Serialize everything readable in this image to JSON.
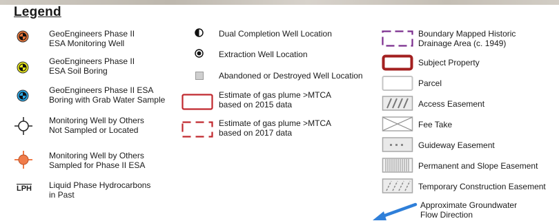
{
  "legend": {
    "title": "Legend",
    "col1": [
      {
        "line1": "GeoEngineers Phase II",
        "line2": "ESA Monitoring Well",
        "color": "#e8763a"
      },
      {
        "line1": "GeoEngineers Phase II",
        "line2": "ESA Soil Boring",
        "color": "#e6e61a"
      },
      {
        "line1": "GeoEngineers Phase II ESA",
        "line2": "Boring with Grab Water Sample",
        "color": "#2aa7e6"
      },
      {
        "line1": "Monitoring Well by Others",
        "line2": "Not Sampled or Located"
      },
      {
        "line1": "Monitoring Well by Others",
        "line2": "Sampled for Phase II ESA",
        "color": "#f07c4a"
      },
      {
        "line1": "Liquid Phase Hydrocarbons",
        "line2": "in Past",
        "symbol_text": "LPH"
      }
    ],
    "col2": [
      {
        "line1": "Dual Completion Well Location"
      },
      {
        "line1": "Extraction Well Location"
      },
      {
        "line1": "Abandoned or Destroyed Well Location"
      },
      {
        "line1": "Estimate of gas plume >MTCA",
        "line2": "based on 2015 data",
        "color": "#c0272d"
      },
      {
        "line1": "Estimate of gas plume >MTCA",
        "line2": "based on 2017 data",
        "color": "#c0272d"
      }
    ],
    "col3": [
      {
        "line1": "Boundary Mapped Historic",
        "line2": "Drainage Area (c. 1949)",
        "color": "#7b2d8e"
      },
      {
        "line1": "Subject Property",
        "color": "#a32020"
      },
      {
        "line1": "Parcel"
      },
      {
        "line1": "Access Easement"
      },
      {
        "line1": "Fee Take"
      },
      {
        "line1": "Guideway Easement"
      },
      {
        "line1": "Permanent and Slope Easement"
      },
      {
        "line1": "Temporary Construction Easement"
      },
      {
        "line1": "Approximate Groundwater",
        "line2": "Flow Direction",
        "color": "#2f7fd9"
      }
    ]
  }
}
